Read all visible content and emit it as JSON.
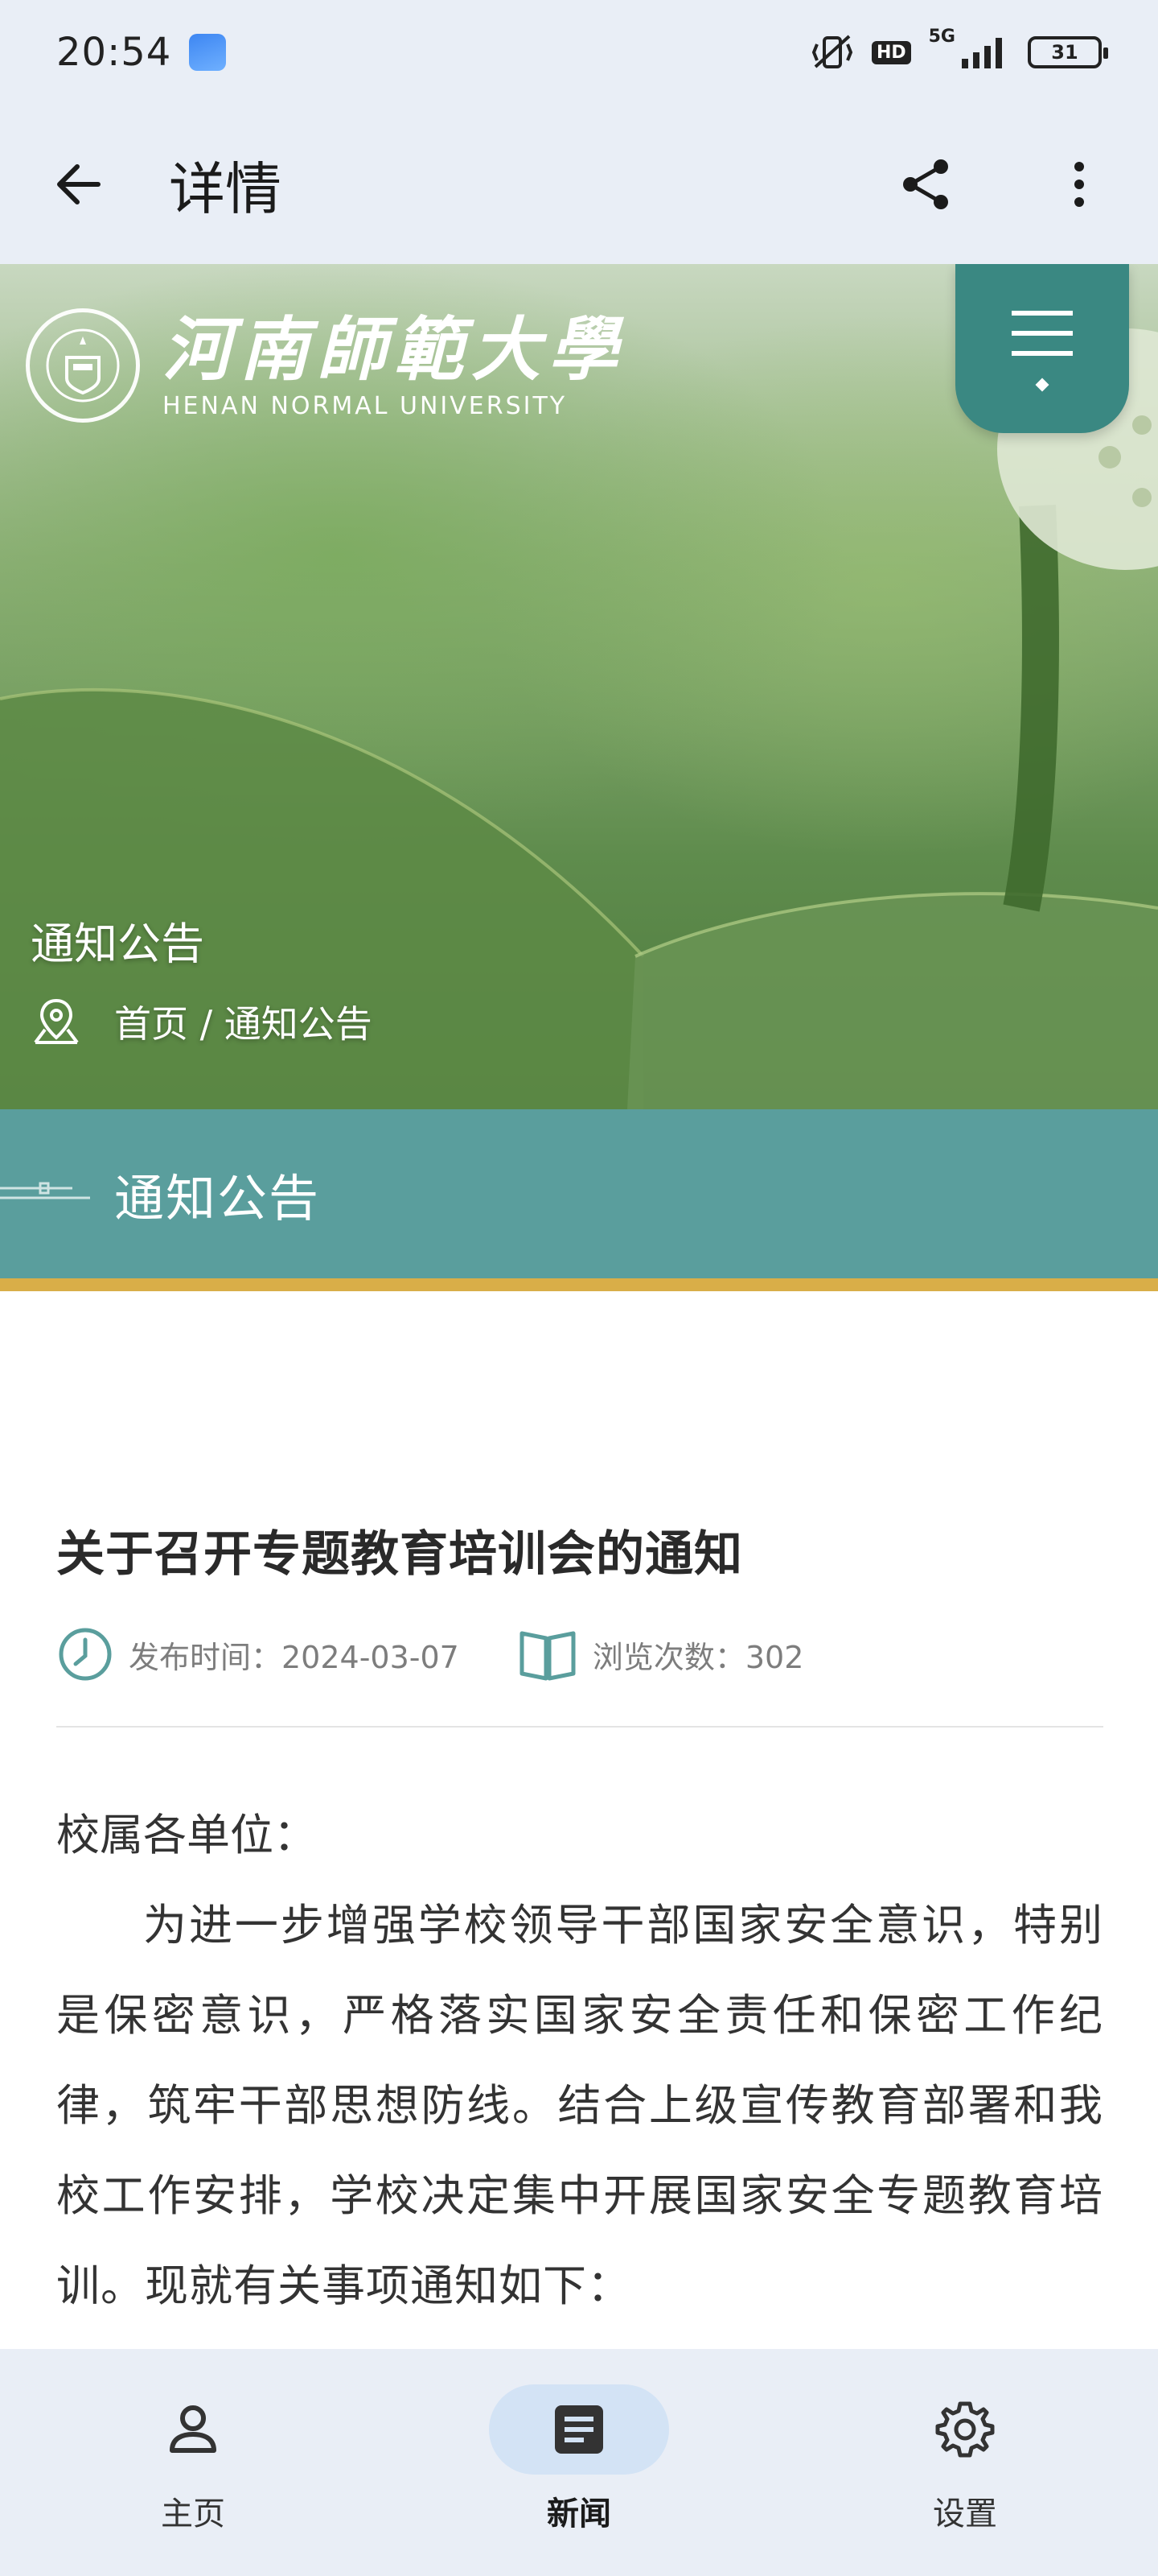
{
  "status_bar": {
    "time": "20:54",
    "network": "5G",
    "hd": "HD",
    "battery": "31",
    "icons": [
      "app-notification-icon",
      "vibrate-icon",
      "hd-icon",
      "signal-icon",
      "battery-icon"
    ]
  },
  "app_bar": {
    "title": "详情",
    "icons": [
      "back-arrow-icon",
      "share-icon",
      "more-vert-icon"
    ]
  },
  "hero": {
    "logo_cn": "河南師範大學",
    "logo_en": "HENAN NORMAL UNIVERSITY",
    "section_title": "通知公告",
    "breadcrumb": "首页 / 通知公告",
    "icons": [
      "university-emblem-icon",
      "hamburger-menu-icon",
      "location-pin-icon"
    ]
  },
  "banner": {
    "title": "通知公告",
    "colors": {
      "teal": "#5a9e9d",
      "gold": "#d9ae48",
      "menu_tab": "#3a8882"
    }
  },
  "article": {
    "title": "关于召开专题教育培训会的通知",
    "publish_label": "发布时间：2024-03-07",
    "views_label": "浏览次数：302",
    "salutation": "校属各单位：",
    "paragraph": "为进一步增强学校领导干部国家安全意识，特别是保密意识，严格落实国家安全责任和保密工作纪律，筑牢干部思想防线。结合上级宣传教育部署和我校工作安排，学校决定集中开展国家安全专题教育培训。现就有关事项通知如下：",
    "icons": [
      "clock-icon",
      "book-icon"
    ]
  },
  "bottom_nav": {
    "items": [
      {
        "label": "主页",
        "icon": "person-icon",
        "active": false
      },
      {
        "label": "新闻",
        "icon": "article-icon",
        "active": true
      },
      {
        "label": "设置",
        "icon": "gear-icon",
        "active": false
      }
    ]
  }
}
